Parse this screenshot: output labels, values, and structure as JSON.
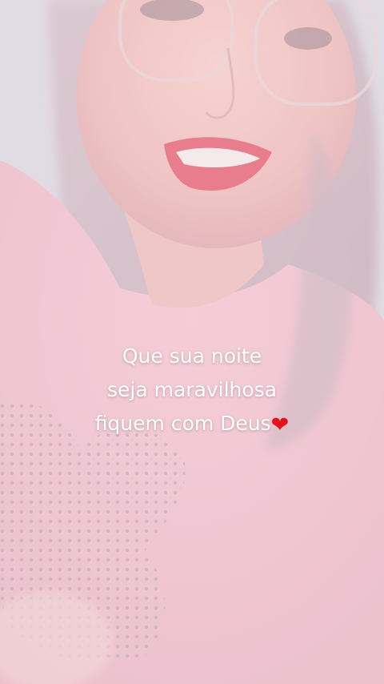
{
  "caption": {
    "line1": "Que sua noite",
    "line2": "seja maravilhosa",
    "line3": "fiquem com Deus",
    "trailing_icon": "heart-icon"
  },
  "colors": {
    "heart": "#e3121d",
    "caption_text": "#ffffff",
    "shirt": "#f0c3d2"
  }
}
